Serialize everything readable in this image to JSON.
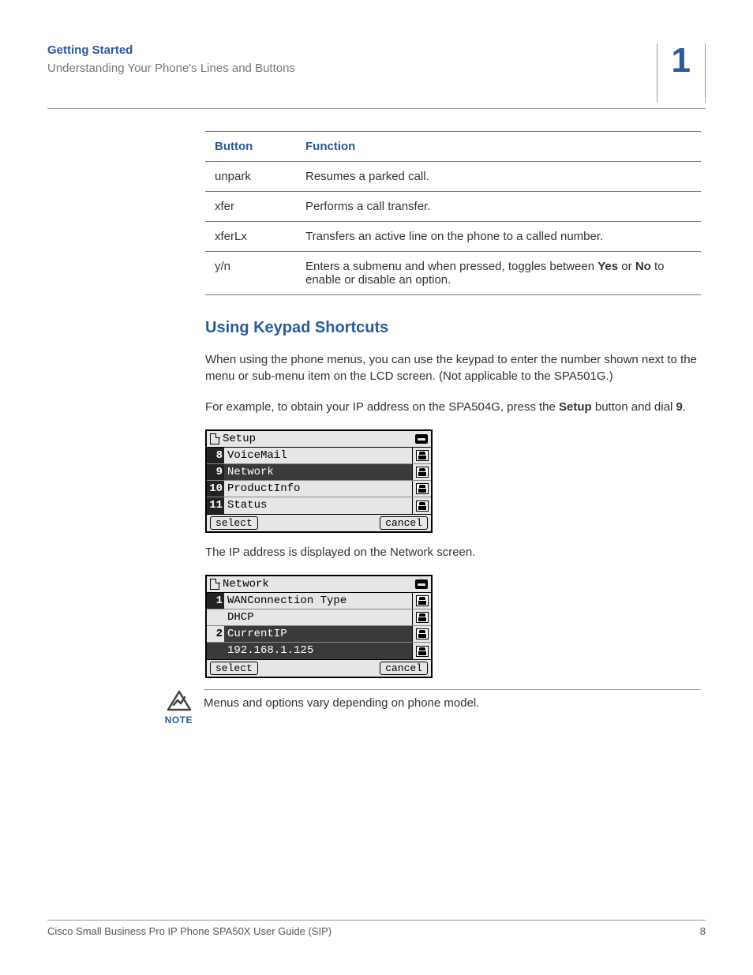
{
  "header": {
    "chapter_title": "Getting Started",
    "section_title": "Understanding Your Phone's Lines and Buttons",
    "chapter_number": "1"
  },
  "table": {
    "col_button": "Button",
    "col_function": "Function",
    "rows": [
      {
        "button": "unpark",
        "function_pre": "Resumes a parked call.",
        "function_b1": "",
        "function_mid": "",
        "function_b2": "",
        "function_post": ""
      },
      {
        "button": "xfer",
        "function_pre": "Performs a call transfer.",
        "function_b1": "",
        "function_mid": "",
        "function_b2": "",
        "function_post": ""
      },
      {
        "button": "xferLx",
        "function_pre": "Transfers an active line on the phone to a called number.",
        "function_b1": "",
        "function_mid": "",
        "function_b2": "",
        "function_post": ""
      },
      {
        "button": "y/n",
        "function_pre": "Enters a submenu and when pressed, toggles between ",
        "function_b1": "Yes",
        "function_mid": " or ",
        "function_b2": "No",
        "function_post": " to enable or disable an option."
      }
    ]
  },
  "section2": {
    "heading": "Using Keypad Shortcuts",
    "para1": "When using the phone menus, you can use the keypad to enter the number shown next to the menu or sub-menu item on the LCD screen. (Not applicable to the SPA501G.)",
    "para2_pre": "For example, to obtain your IP address on the SPA504G, press the ",
    "para2_b1": "Setup",
    "para2_mid": " button and dial ",
    "para2_b2": "9",
    "para2_post": "."
  },
  "lcd1": {
    "title": "Setup",
    "rows": [
      {
        "num": "8",
        "label": "VoiceMail",
        "selected": false,
        "inset": false,
        "hasNum": true
      },
      {
        "num": "9",
        "label": "Network",
        "selected": true,
        "inset": false,
        "hasNum": true
      },
      {
        "num": "10",
        "label": "ProductInfo",
        "selected": false,
        "inset": false,
        "hasNum": true
      },
      {
        "num": "11",
        "label": "Status",
        "selected": false,
        "inset": false,
        "hasNum": true
      }
    ],
    "soft_left": "select",
    "soft_right": "cancel"
  },
  "caption1": "The IP address is displayed on the Network screen.",
  "lcd2": {
    "title": "Network",
    "rows": [
      {
        "num": "1",
        "label": "WANConnection Type",
        "selected": false,
        "inset": false,
        "hasNum": true
      },
      {
        "num": "",
        "label": "DHCP",
        "selected": false,
        "inset": true,
        "hasNum": false
      },
      {
        "num": "2",
        "label": "CurrentIP",
        "selected": true,
        "inset": false,
        "hasNum": true
      },
      {
        "num": "",
        "label": "192.168.1.125",
        "selected": true,
        "inset": true,
        "hasNum": false
      }
    ],
    "soft_left": "select",
    "soft_right": "cancel"
  },
  "note": {
    "label": "NOTE",
    "text": "Menus and options vary depending on phone model."
  },
  "footer": {
    "left": "Cisco Small Business Pro IP Phone SPA50X User Guide (SIP)",
    "right": "8"
  }
}
